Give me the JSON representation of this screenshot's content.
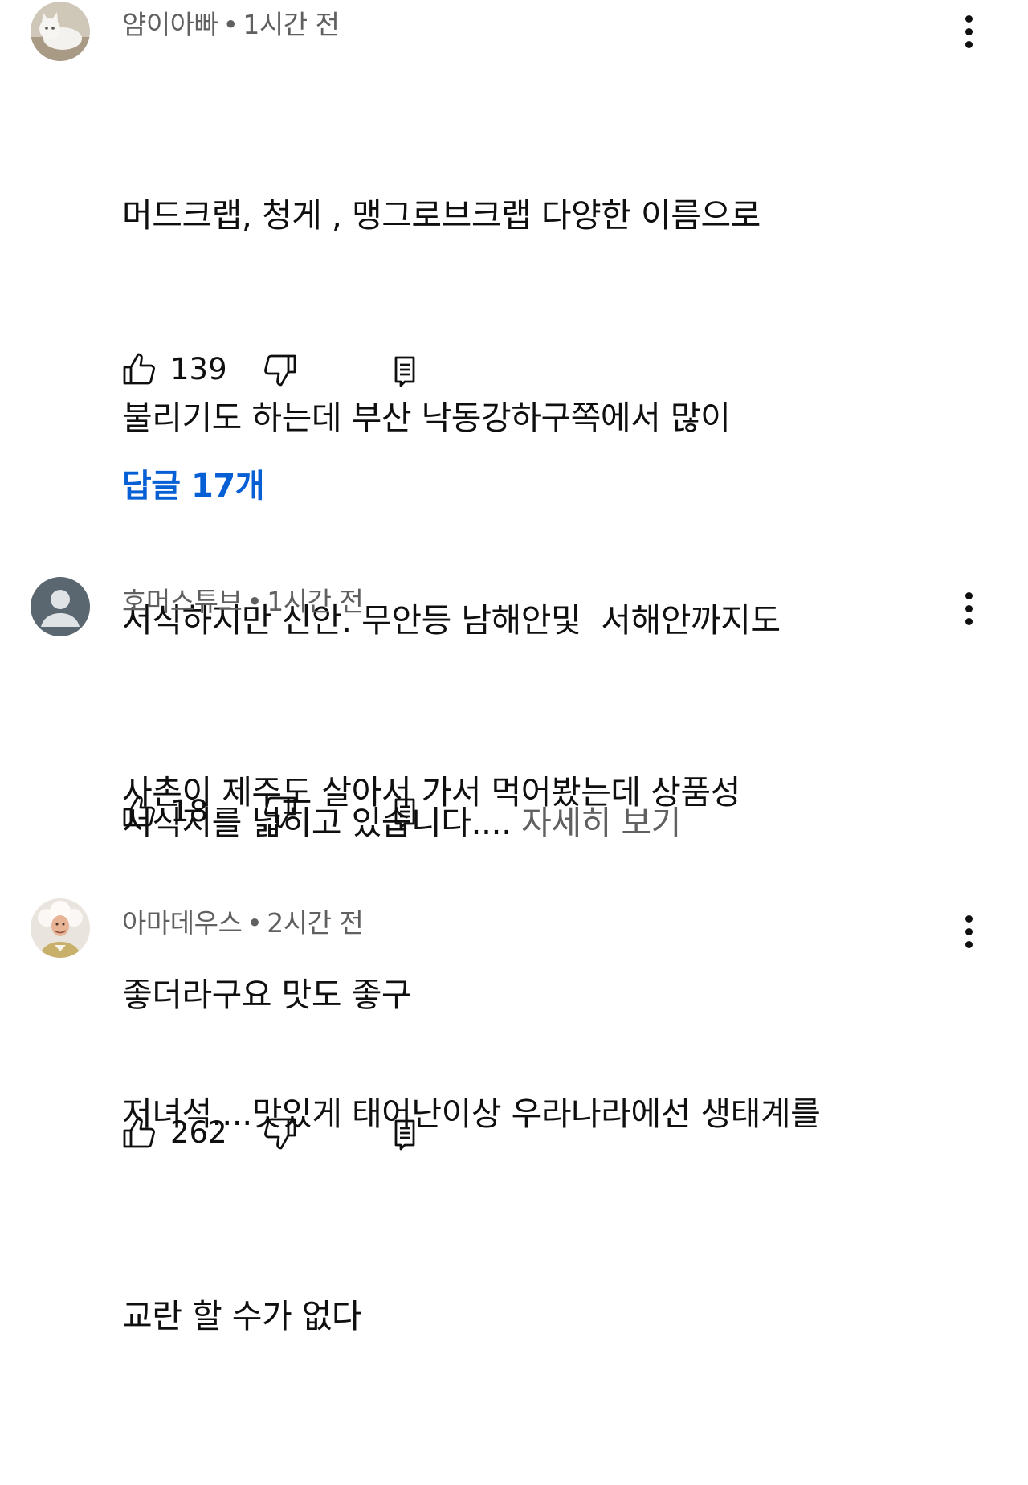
{
  "comments": [
    {
      "author": "얌이아빠",
      "time": "1시간 전",
      "avatar": "cat-avatar",
      "lines": [
        "머드크랩, 청게 , 맹그로브크랩 다양한 이름으로",
        "불리기도 하는데 부산 낙동강하구쪽에서 많이",
        "서식하지만 신안. 무안등 남해안및  서해안까지도",
        "서식지를 넓히고 있습니다...."
      ],
      "read_more": " 자세히 보기",
      "likes": "139",
      "replies_label": "답글 17개"
    },
    {
      "author": "호머스튜브",
      "time": "1시간 전",
      "avatar": "default-person-avatar",
      "lines": [
        "사촌이 제주도 살아서 가서 먹어봤는데 상품성",
        "좋더라구요 맛도 좋구"
      ],
      "likes": "18"
    },
    {
      "author": "아마데우스",
      "time": "2시간 전",
      "avatar": "wig-person-avatar",
      "lines": [
        "저녀석....맛있게 태어난이상 우라나라에선 생태계를",
        "교란 할 수가 없다"
      ],
      "likes": "262"
    }
  ],
  "separator": "•",
  "colors": {
    "text": "#0f0f0f",
    "meta": "#606060",
    "link": "#065fd4"
  },
  "icons": {
    "like": "thumb-up-icon",
    "dislike": "thumb-down-icon",
    "reply": "reply-icon",
    "more": "more-vert-icon"
  }
}
